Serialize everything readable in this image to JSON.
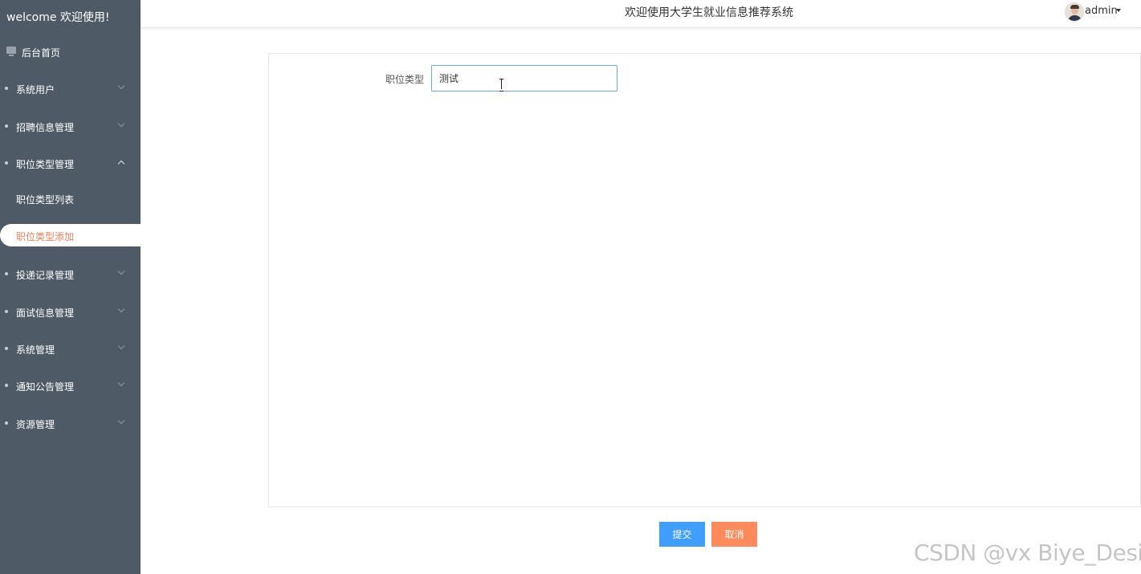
{
  "sidebar": {
    "brand": "welcome 欢迎使用!",
    "home_label": "后台首页",
    "items": [
      {
        "label": "系统用户",
        "expanded": false
      },
      {
        "label": "招聘信息管理",
        "expanded": false
      },
      {
        "label": "职位类型管理",
        "expanded": true
      },
      {
        "label": "投递记录管理",
        "expanded": false
      },
      {
        "label": "面试信息管理",
        "expanded": false
      },
      {
        "label": "系统管理",
        "expanded": false
      },
      {
        "label": "通知公告管理",
        "expanded": false
      },
      {
        "label": "资源管理",
        "expanded": false
      }
    ],
    "sub_items": [
      {
        "label": "职位类型列表",
        "active": false
      },
      {
        "label": "职位类型添加",
        "active": true
      }
    ]
  },
  "header": {
    "title": "欢迎使用大学生就业信息推荐系统",
    "user_name": "admin"
  },
  "form": {
    "field_label": "职位类型",
    "field_value": "测试",
    "submit_label": "提交",
    "cancel_label": "取消"
  },
  "watermark": "CSDN @vx Biye_Design",
  "colors": {
    "sidebar_bg": "#4e5a66",
    "active_item_text": "#f0805a",
    "submit_button": "#409eff",
    "cancel_button": "#ff8a5c",
    "input_border": "#6aa8e6"
  },
  "icons": {
    "home": "monitor-icon",
    "expand": "chevron-down-icon",
    "collapse": "chevron-up-icon",
    "user_menu": "caret-down-icon"
  }
}
